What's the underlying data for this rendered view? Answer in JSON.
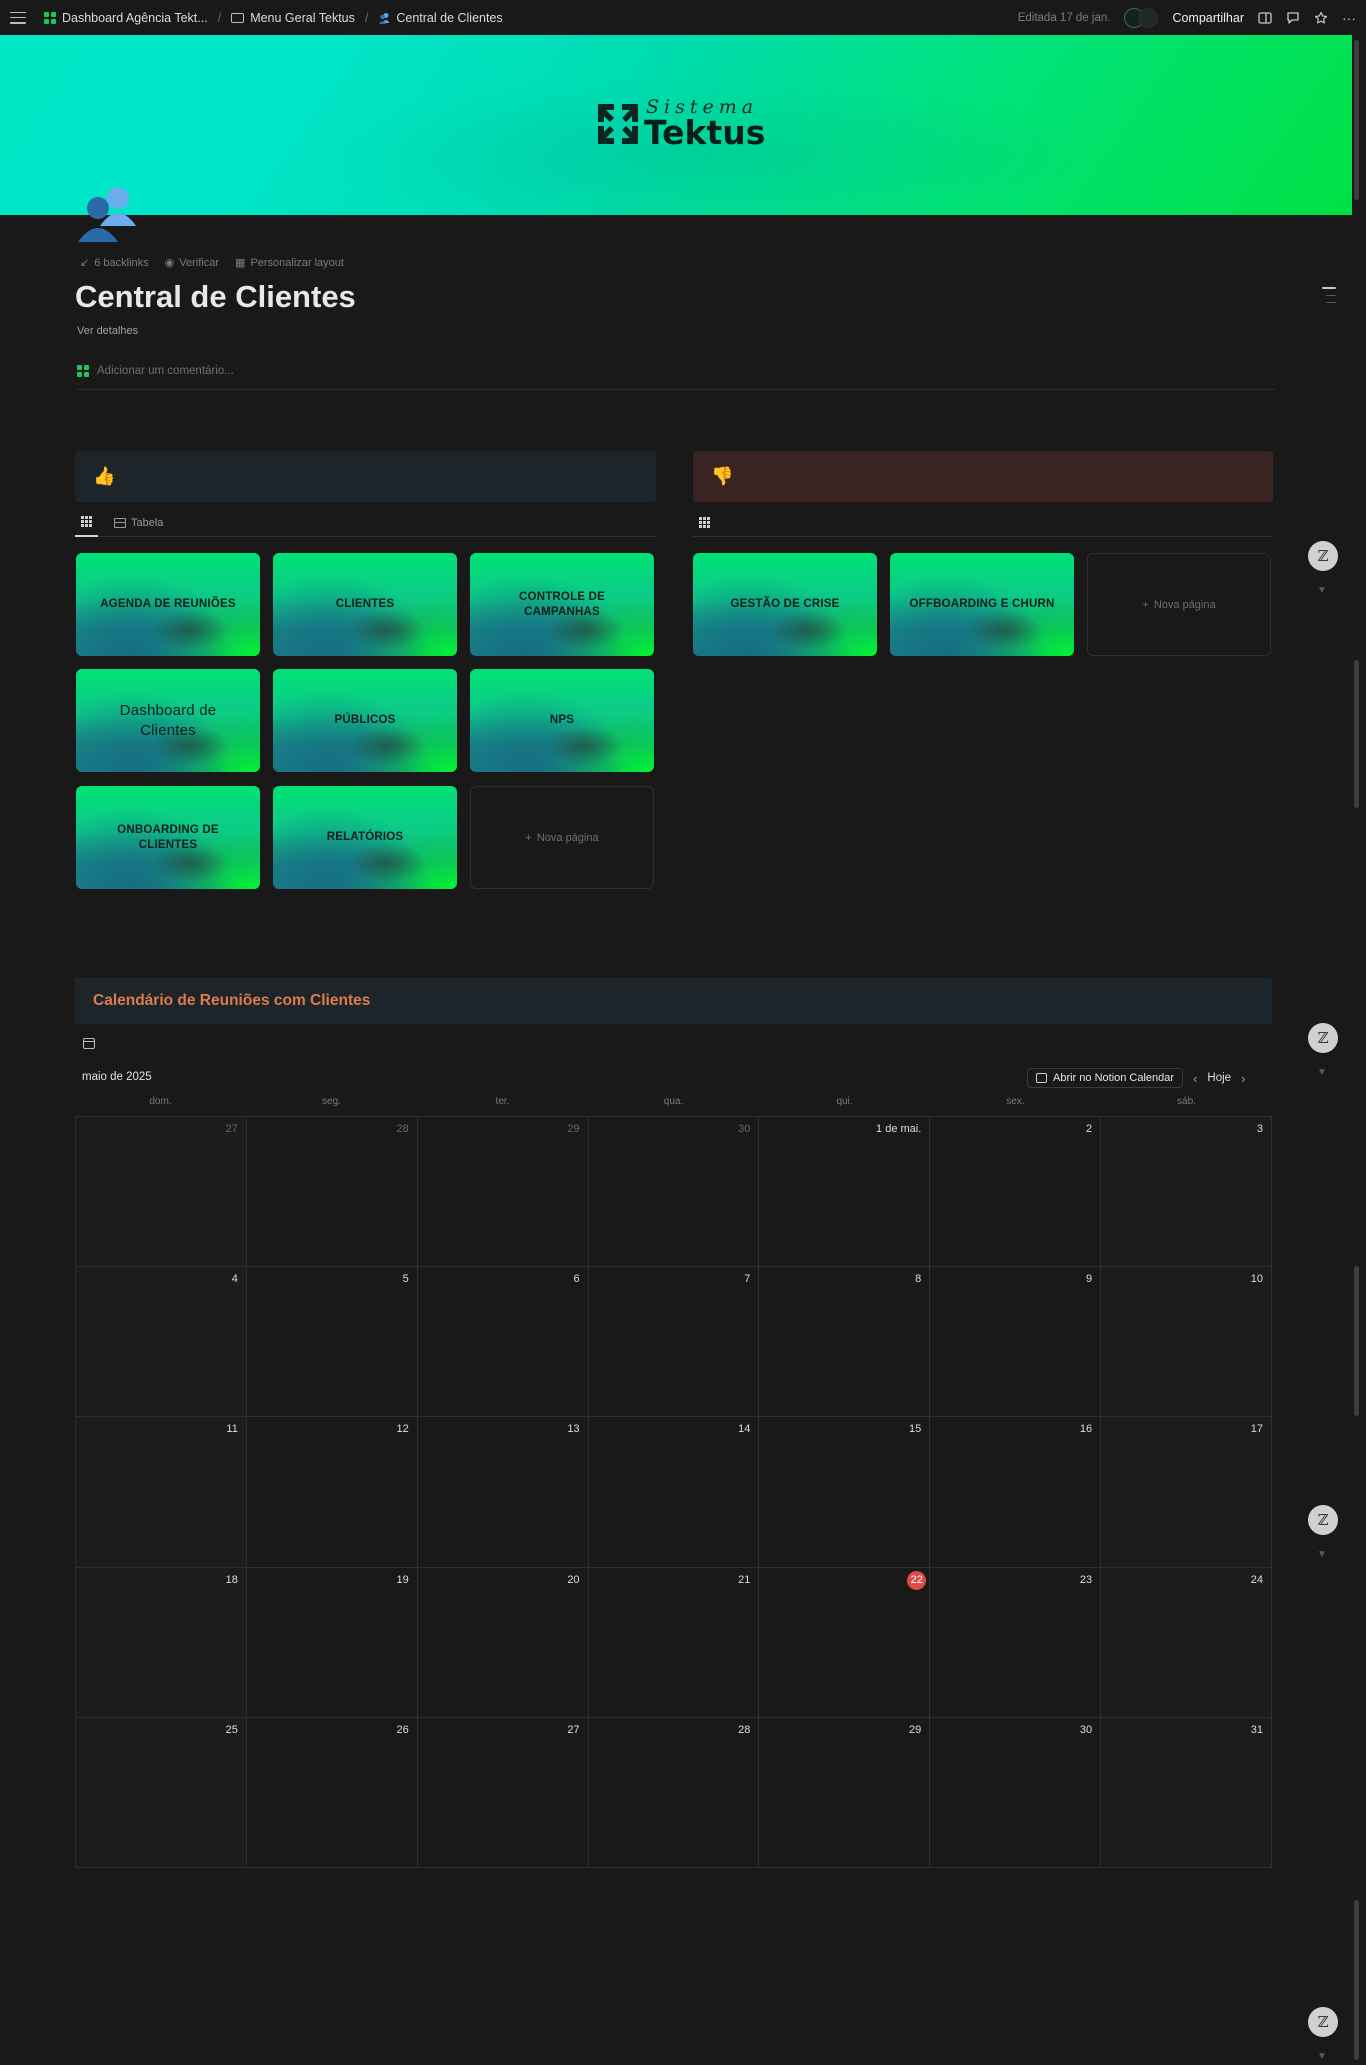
{
  "topbar": {
    "breadcrumbs": [
      "Dashboard Agência Tekt...",
      "Menu Geral Tektus",
      "Central de Clientes"
    ],
    "edited": "Editada 17 de jan.",
    "share_label": "Compartilhar"
  },
  "cover": {
    "brand_sub": "Sistema",
    "brand_main": "Tektus"
  },
  "page": {
    "meta": [
      "6 backlinks",
      "Verificar",
      "Personalizar layout"
    ],
    "title": "Central de Clientes",
    "details_link": "Ver detalhes",
    "comment_placeholder": "Adicionar um comentário..."
  },
  "left_section": {
    "callout_icon": "thumbs-up-icon",
    "tabs": [
      "",
      "Tabela"
    ],
    "cards": [
      "AGENDA DE REUNIÕES",
      "CLIENTES",
      "CONTROLE DE CAMPANHAS",
      "Dashboard de Clientes",
      "PÚBLICOS",
      "NPS",
      "ONBOARDING DE CLIENTES",
      "RELATÓRIOS"
    ],
    "new_page": "Nova página"
  },
  "right_section": {
    "callout_icon": "thumbs-down-icon",
    "cards": [
      "GESTÃO DE CRISE",
      "OFFBOARDING E CHURN"
    ],
    "new_page": "Nova página"
  },
  "calendar": {
    "title": "Calendário de Reuniões com Clientes",
    "month": "maio de 2025",
    "open_button": "Abrir no Notion Calendar",
    "today_button": "Hoje",
    "weekdays": [
      "dom.",
      "seg.",
      "ter.",
      "qua.",
      "qui.",
      "sex.",
      "sáb."
    ],
    "days": [
      "27",
      "28",
      "29",
      "30",
      "1 de mai.",
      "2",
      "3",
      "4",
      "5",
      "6",
      "7",
      "8",
      "9",
      "10",
      "11",
      "12",
      "13",
      "14",
      "15",
      "16",
      "17",
      "18",
      "19",
      "20",
      "21",
      "22",
      "23",
      "24",
      "25",
      "26",
      "27",
      "28",
      "29",
      "30",
      "31"
    ],
    "muted_days": 4,
    "today": "22"
  },
  "colors": {
    "accent_orange": "#dd7b4b",
    "today_red": "#dd4b47",
    "brand_green": "#21c25e"
  }
}
